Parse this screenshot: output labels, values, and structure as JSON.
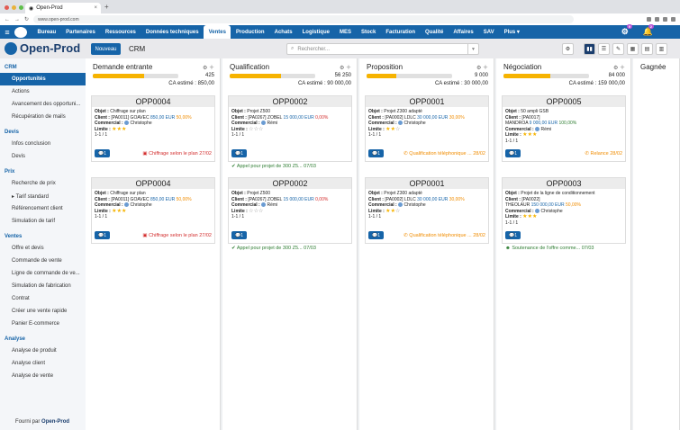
{
  "browser": {
    "tab_title": "Open-Prod",
    "url": "www.open-prod.com"
  },
  "nav": {
    "items": [
      "Bureau",
      "Partenaires",
      "Ressources",
      "Données techniques",
      "Ventes",
      "Production",
      "Achats",
      "Logistique",
      "MES",
      "Stock",
      "Facturation",
      "Qualité",
      "Affaires",
      "SAV",
      "Plus ▾"
    ],
    "active": "Ventes",
    "badge1": "9",
    "badge2": "2"
  },
  "brand": "Open-Prod",
  "header": {
    "new_label": "Nouveau",
    "title": "CRM",
    "search_placeholder": "Rechercher..."
  },
  "sidebar": {
    "sections": [
      {
        "title": "CRM",
        "items": [
          "Opportunités",
          "Actions",
          "Avancement des opportuni...",
          "Récupération de mails"
        ]
      },
      {
        "title": "Devis",
        "items": [
          "Infos conclusion",
          "Devis"
        ]
      },
      {
        "title": "Prix",
        "items": [
          "Recherche de prix",
          "▸ Tarif standard",
          "Référencement client",
          "Simulation de tarif"
        ]
      },
      {
        "title": "Ventes",
        "items": [
          "Offre et devis",
          "Commande de vente",
          "Ligne de commande de ve...",
          "Simulation de fabrication",
          "Contrat",
          "Créer une vente rapide",
          "Panier E-commerce"
        ]
      },
      {
        "title": "Analyse",
        "items": [
          "Analyse de produit",
          "Analyse client",
          "Analyse de vente"
        ]
      }
    ],
    "active": "Opportunités",
    "footer_prefix": "Fourni par",
    "footer_brand": "Open-Prod"
  },
  "columns": [
    {
      "name": "Demande entrante",
      "amount": "425",
      "progress": 0.6,
      "ca": "CA estimé : 850,00",
      "cards": [
        {
          "ref": "OPP0004",
          "objet": "Chiffrage sur plan",
          "client": "[PA0011] GOAVEC",
          "price": "850,00 EUR",
          "pct": "50,00%",
          "commercial": "Christophe",
          "stars": 3,
          "count": "1-1 / 1",
          "chip": "1",
          "action": "▣ Chiffrage selon le plan 27/02",
          "action_color": "red"
        },
        {
          "ref": "OPP0004",
          "objet": "Chiffrage sur plan",
          "client": "[PA0011] GOAVEC",
          "price": "850,00 EUR",
          "pct": "50,00%",
          "commercial": "Christophe",
          "stars": 3,
          "count": "1-1 / 1",
          "chip": "1",
          "action": "▣ Chiffrage selon le plan 27/02",
          "action_color": "red"
        }
      ]
    },
    {
      "name": "Qualification",
      "amount": "56 250",
      "progress": 0.6,
      "ca": "CA estimé : 90 000,00",
      "cards": [
        {
          "ref": "OPP0002",
          "objet": "Projet Z500",
          "client": "[PA0267] ZOBEL",
          "price": "15 000,00 EUR",
          "pct": "0,00%",
          "commercial": "Rémi",
          "stars": 0,
          "count": "1-1 / 1",
          "chip": "1",
          "below": "✔ Appel pour projet de 300 Z5... 07/03",
          "below_color": "green"
        },
        {
          "ref": "OPP0002",
          "objet": "Projet Z500",
          "client": "[PA0267] ZOBEL",
          "price": "15 000,00 EUR",
          "pct": "0,00%",
          "commercial": "Rémi",
          "stars": 0,
          "count": "1-1 / 1",
          "chip": "1",
          "below": "✔ Appel pour projet de 300 Z5... 07/03",
          "below_color": "green"
        }
      ]
    },
    {
      "name": "Proposition",
      "amount": "9 000",
      "progress": 0.35,
      "ca": "CA estimé : 30 000,00",
      "cards": [
        {
          "ref": "OPP0001",
          "objet": "Projet Z300 adapté",
          "client": "[PA0002] LDLC",
          "price": "30 000,00 EUR",
          "pct": "30,00%",
          "commercial": "Christophe",
          "stars": 2,
          "count": "1-1 / 1",
          "chip": "1",
          "action": "✆ Qualification téléphonique ... 28/02",
          "action_color": "orange"
        },
        {
          "ref": "OPP0001",
          "objet": "Projet Z300 adapté",
          "client": "[PA0002] LDLC",
          "price": "30 000,00 EUR",
          "pct": "30,00%",
          "commercial": "Christophe",
          "stars": 2,
          "count": "1-1 / 1",
          "chip": "1",
          "action": "✆ Qualification téléphonique ... 28/02",
          "action_color": "orange"
        }
      ]
    },
    {
      "name": "Négociation",
      "amount": "84 000",
      "progress": 0.55,
      "ca": "CA estimé : 159 000,00",
      "cards": [
        {
          "ref": "OPP0005",
          "objet": "50 ampli GSB",
          "client": "[PA0017]",
          "client2": "MANDROA",
          "price": "9 000,00 EUR",
          "pct": "100,00%",
          "commercial": "Rémi",
          "stars": 3,
          "count": "1-1 / 1",
          "chip": "1",
          "action": "✆ Relance 28/02",
          "action_color": "orange"
        },
        {
          "ref": "OPP0003",
          "objet": "Projet de la ligne de conditionnement",
          "client": "[PA0022]",
          "client2": "THEOLAUR",
          "price": "150 000,00 EUR",
          "pct": "50,00%",
          "commercial": "Christophe",
          "stars": 3,
          "count": "1-1 / 1",
          "chip": "1",
          "below": "☻ Soutenance de l'offre comme... 07/03",
          "below_color": "green"
        }
      ]
    },
    {
      "name": "Gagnée",
      "cards": []
    }
  ]
}
